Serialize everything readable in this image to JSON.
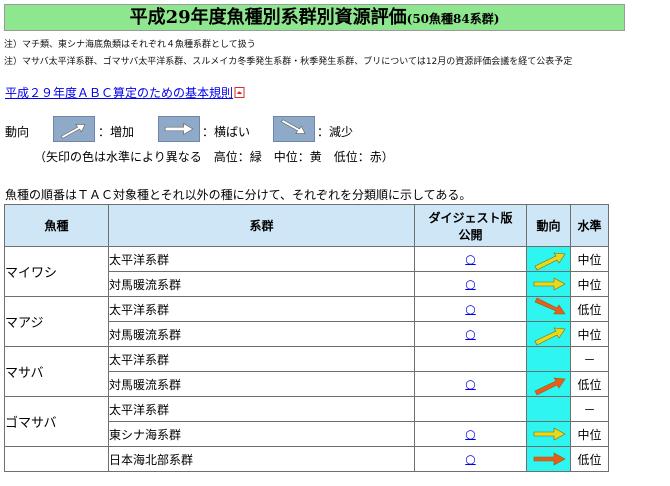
{
  "title": {
    "main": "平成29年度魚種別系群別資源評価",
    "sub": "(50魚種84系群)"
  },
  "notes": [
    "注）マチ類、東シナ海底魚類はそれぞれ４魚種系群として扱う",
    "注）マサバ太平洋系群、ゴマサバ太平洋系群、スルメイカ冬季発生系群・秋季発生系群、ブリについては12月の資源評価会議を経て公表予定"
  ],
  "rule_link": "平成２９年度ＡＢＣ算定のための基本規則",
  "legend": {
    "label": "動向",
    "items": [
      {
        "label": "：増加",
        "icon": "arrow-up-right-icon"
      },
      {
        "label": "：横ばい",
        "icon": "arrow-right-icon"
      },
      {
        "label": "：減少",
        "icon": "arrow-down-right-icon"
      }
    ],
    "note": "（矢印の色は水準により異なる　高位：緑　中位：黄　低位：赤）"
  },
  "intro": "魚種の順番はＴＡＣ対象種とそれ以外の種に分けて、それぞれを分類順に示してある。",
  "table": {
    "headers": {
      "species": "魚種",
      "stock": "系群",
      "digest_line1": "ダイジェスト版",
      "digest_line2": "公開",
      "trend": "動向",
      "level": "水準"
    },
    "groups": [
      {
        "species": "マイワシ",
        "rows": [
          {
            "stock": "太平洋系群",
            "digest": "○",
            "trend": "up",
            "trend_color": "#e8d81e",
            "level": "中位"
          },
          {
            "stock": "対馬暖流系群",
            "digest": "○",
            "trend": "flat",
            "trend_color": "#e8d81e",
            "level": "中位"
          }
        ]
      },
      {
        "species": "マアジ",
        "rows": [
          {
            "stock": "太平洋系群",
            "digest": "○",
            "trend": "down",
            "trend_color": "#ee5a1c",
            "level": "低位"
          },
          {
            "stock": "対馬暖流系群",
            "digest": "○",
            "trend": "up",
            "trend_color": "#e8d81e",
            "level": "中位"
          }
        ]
      },
      {
        "species": "マサバ",
        "rows": [
          {
            "stock": "太平洋系群",
            "digest": "",
            "trend": "",
            "trend_color": "",
            "level": "－"
          },
          {
            "stock": "対馬暖流系群",
            "digest": "○",
            "trend": "up",
            "trend_color": "#ee5a1c",
            "level": "低位"
          }
        ]
      },
      {
        "species": "ゴマサバ",
        "rows": [
          {
            "stock": "太平洋系群",
            "digest": "",
            "trend": "",
            "trend_color": "",
            "level": "－"
          },
          {
            "stock": "東シナ海系群",
            "digest": "○",
            "trend": "flat",
            "trend_color": "#e8d81e",
            "level": "中位"
          }
        ]
      },
      {
        "species": "",
        "rows": [
          {
            "stock": "日本海北部系群",
            "digest": "○",
            "trend": "flat",
            "trend_color": "#ee5a1c",
            "level": "低位"
          }
        ]
      }
    ]
  }
}
